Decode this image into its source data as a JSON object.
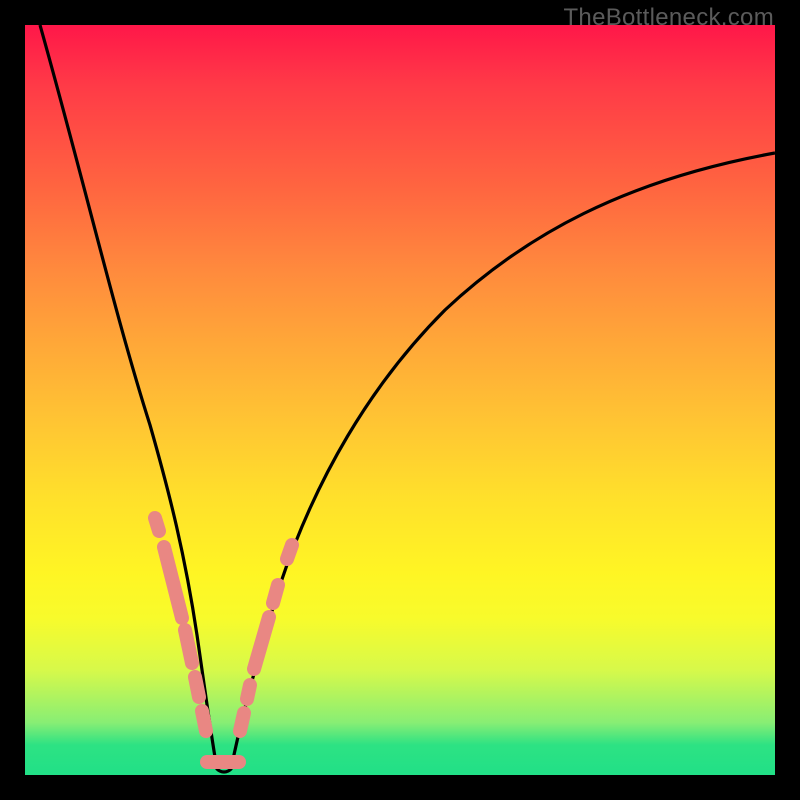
{
  "watermark": "TheBottleneck.com",
  "chart_data": {
    "type": "line",
    "title": "",
    "xlabel": "",
    "ylabel": "",
    "xlim": [
      0,
      100
    ],
    "ylim": [
      0,
      100
    ],
    "grid": false,
    "series": [
      {
        "name": "curve",
        "color": "#000000",
        "x": [
          2,
          6,
          10,
          14,
          17,
          19,
          21,
          22.5,
          24,
          25.5,
          27,
          30,
          34,
          40,
          48,
          58,
          70,
          84,
          100
        ],
        "y": [
          100,
          85,
          70,
          55,
          42,
          34,
          24,
          14,
          4,
          0,
          4,
          14,
          28,
          44,
          58,
          70,
          79,
          85,
          89
        ]
      },
      {
        "name": "band-left",
        "color": "#e98783",
        "x": [
          17,
          22.8
        ],
        "y": [
          34,
          5
        ]
      },
      {
        "name": "band-right",
        "color": "#e98783",
        "x": [
          27.2,
          34
        ],
        "y": [
          5,
          28
        ]
      },
      {
        "name": "band-bottom",
        "color": "#e98783",
        "x": [
          23.5,
          27.5
        ],
        "y": [
          0.8,
          0.8
        ]
      }
    ],
    "notes": "V-shaped bottleneck curve over a red→yellow→green vertical gradient background. Pink dashed bands overlay the lower part of the V. Axes and ticks are not shown; values are estimated proportions of the plot area (0–100)."
  }
}
